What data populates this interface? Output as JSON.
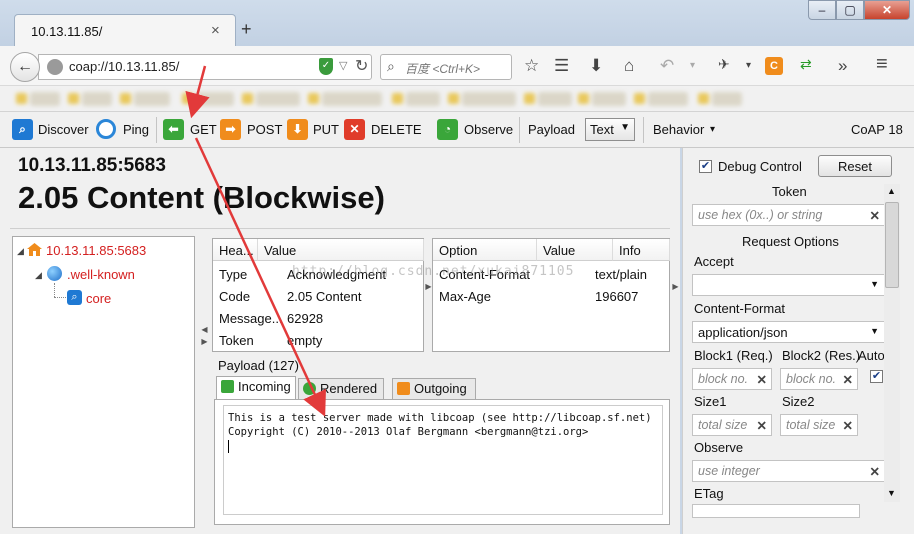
{
  "browser": {
    "tab_title": "10.13.11.85/",
    "tab_close": "×",
    "new_tab": "+",
    "url": "coap://10.13.11.85/",
    "search_placeholder": "百度 <Ctrl+K>",
    "window_controls": {
      "minimize": "–",
      "maximize": "▢",
      "close": "✕"
    }
  },
  "toolbar": {
    "discover": "Discover",
    "ping": "Ping",
    "get": "GET",
    "post": "POST",
    "put": "PUT",
    "delete": "DELETE",
    "observe": "Observe",
    "payload_label": "Payload",
    "payload_type": "Text",
    "behavior": "Behavior",
    "behavior_arrow": "▾",
    "version": "CoAP 18"
  },
  "response": {
    "address": "10.13.11.85:5683",
    "status": "2.05 Content (Blockwise)"
  },
  "tree": {
    "root": "10.13.11.85:5683",
    "child": ".well-known",
    "leaf": "core"
  },
  "headers_table": {
    "columns": [
      "Hea...",
      "Value"
    ],
    "rows": [
      [
        "Type",
        "Acknowledgment"
      ],
      [
        "Code",
        "2.05 Content"
      ],
      [
        "Message...",
        "62928"
      ],
      [
        "Token",
        "empty"
      ]
    ]
  },
  "options_table": {
    "columns": [
      "Option",
      "Value",
      "Info"
    ],
    "rows": [
      [
        "Content-Format",
        "text/plain",
        ""
      ],
      [
        "Max-Age",
        "196607",
        ""
      ]
    ]
  },
  "payload": {
    "label": "Payload (127)",
    "tabs": [
      "Incoming",
      "Rendered",
      "Outgoing"
    ],
    "lines": [
      "This is a test server made with libcoap (see http://libcoap.sf.net)",
      "Copyright (C) 2010--2013 Olaf Bergmann <bergmann@tzi.org>"
    ]
  },
  "right_panel": {
    "debug_control": "Debug Control",
    "reset": "Reset",
    "token_label": "Token",
    "token_placeholder": "use hex (0x..) or string",
    "request_options": "Request Options",
    "accept": "Accept",
    "accept_value": "",
    "content_format": "Content-Format",
    "content_format_value": "application/json",
    "block1": "Block1 (Req.)",
    "block2": "Block2 (Res.)",
    "auto": "Auto",
    "block_placeholder": "block no.",
    "size1": "Size1",
    "size2": "Size2",
    "size_placeholder": "total size",
    "observe": "Observe",
    "observe_placeholder": "use integer",
    "etag": "ETag"
  },
  "watermark": "http://blog.csdn.net/xukai871105",
  "colors": {
    "tree_link": "#d42020",
    "get_green": "#3aa63a",
    "post_orange": "#f08c1c",
    "delete_red": "#e03c2a"
  }
}
